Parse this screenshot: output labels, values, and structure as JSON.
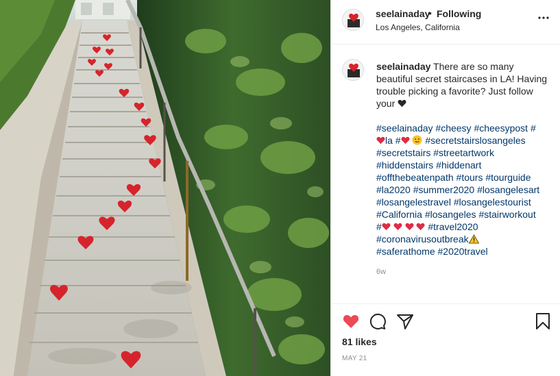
{
  "post": {
    "username": "seelainaday",
    "separator": "•",
    "follow_status": "Following",
    "location": "Los Angeles, California"
  },
  "caption": {
    "username": "seelainaday",
    "text": "There are so many beautiful secret staircases in LA! Having trouble picking a favorite? Just follow your"
  },
  "hashtags": {
    "seelainaday": "#seelainaday",
    "cheesy": "#cheesy",
    "cheesypost": "#cheesypost",
    "hash": "#",
    "la": "la",
    "secretstairslosangeles": "#secretstairslosangeles",
    "secretstairs": "#secretstairs",
    "streetartwork": "#streetartwork",
    "hiddenstairs": "#hiddenstairs",
    "hiddenart": "#hiddenart",
    "offthebeatenpath": "#offthebeatenpath",
    "tours": "#tours",
    "tourguide": "#tourguide",
    "la2020": "#la2020",
    "summer2020": "#summer2020",
    "losangelesart": "#losangelesart",
    "losangelestravel": "#losangelestravel",
    "losangelestourist": "#losangelestourist",
    "california": "#California",
    "losangeles": "#losangeles",
    "stairworkout": "#stairworkout",
    "travel2020": "#travel2020",
    "coronavirusoutbreak": "#coronavirusoutbreak",
    "saferathome": "#saferathome",
    "travel2020b": "#2020travel"
  },
  "timestamp_relative": "6w",
  "likes": "81 likes",
  "date": "MAY 21",
  "colors": {
    "heart_red": "#ed4956",
    "link_blue": "#00376b",
    "muted_gray": "#8e8e8e"
  },
  "icons": [
    "more-options-icon",
    "like-heart-icon",
    "comment-icon",
    "share-icon",
    "save-bookmark-icon"
  ]
}
